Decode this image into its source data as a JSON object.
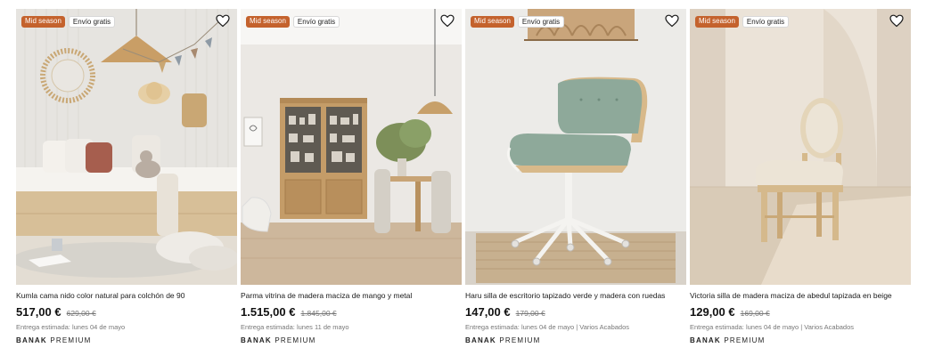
{
  "products": [
    {
      "badge_sale": "Mid season",
      "badge_shipping": "Envío gratis",
      "title": "Kumla cama nido color natural para colchón de 90",
      "price": "517,00 €",
      "old_price": "629,00 €",
      "delivery": "Entrega estimada: lunes 04 de mayo",
      "brand_name": "BANAK",
      "brand_tier": "PREMIUM",
      "image_subject": "bed"
    },
    {
      "badge_sale": "Mid season",
      "badge_shipping": "Envío gratis",
      "title": "Parma vitrina de madera maciza de mango y metal",
      "price": "1.515,00 €",
      "old_price": "1.845,00 €",
      "delivery": "Entrega estimada: lunes 11 de mayo",
      "brand_name": "BANAK",
      "brand_tier": "PREMIUM",
      "image_subject": "display-cabinet"
    },
    {
      "badge_sale": "Mid season",
      "badge_shipping": "Envío gratis",
      "title": "Haru silla de escritorio tapizado verde y madera con ruedas",
      "price": "147,00 €",
      "old_price": "179,00 €",
      "delivery": "Entrega estimada: lunes 04 de mayo | Varios Acabados",
      "brand_name": "BANAK",
      "brand_tier": "PREMIUM",
      "image_subject": "office-chair"
    },
    {
      "badge_sale": "Mid season",
      "badge_shipping": "Envío gratis",
      "title": "Victoria silla de madera maciza de abedul tapizada en beige",
      "price": "129,00 €",
      "old_price": "169,00 €",
      "delivery": "Entrega estimada: lunes 04 de mayo | Varios Acabados",
      "brand_name": "BANAK",
      "brand_tier": "PREMIUM",
      "image_subject": "dining-chair"
    }
  ],
  "icons": {
    "favorite": "heart-outline-icon"
  },
  "colors": {
    "sale_badge": "#c4622d",
    "text": "#1a1a1a",
    "muted": "#777777"
  }
}
